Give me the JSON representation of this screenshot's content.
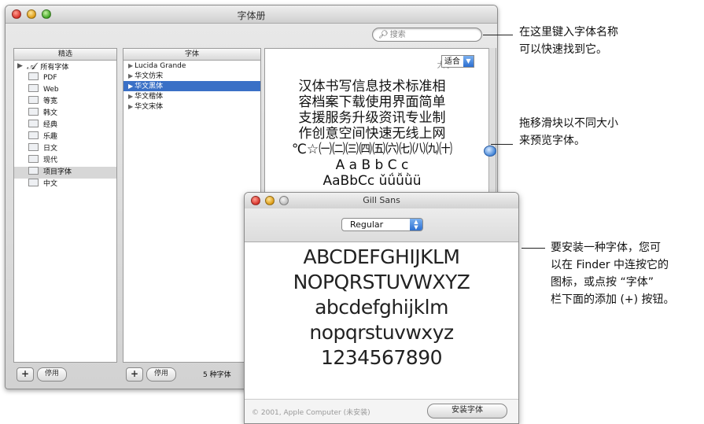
{
  "window": {
    "title": "字体册",
    "search_placeholder": "搜索",
    "search_icon": "magnifier-icon"
  },
  "collections": {
    "header": "精选",
    "items": [
      {
        "label": "所有字体",
        "icon": "all-fonts-icon"
      },
      {
        "label": "PDF",
        "icon": "collection-icon"
      },
      {
        "label": "Web",
        "icon": "collection-icon"
      },
      {
        "label": "等宽",
        "icon": "collection-icon"
      },
      {
        "label": "韩文",
        "icon": "collection-icon"
      },
      {
        "label": "经典",
        "icon": "collection-icon"
      },
      {
        "label": "乐趣",
        "icon": "collection-icon"
      },
      {
        "label": "日文",
        "icon": "collection-icon"
      },
      {
        "label": "现代",
        "icon": "collection-icon"
      },
      {
        "label": "项目字体",
        "icon": "collection-icon",
        "selected": true
      },
      {
        "label": "中文",
        "icon": "collection-icon"
      }
    ],
    "add_label": "+",
    "disable_label": "停用"
  },
  "fonts": {
    "header": "字体",
    "items": [
      {
        "label": "Lucida Grande"
      },
      {
        "label": "华文仿宋"
      },
      {
        "label": "华文黑体",
        "selected": true
      },
      {
        "label": "华文楷体"
      },
      {
        "label": "华文宋体"
      }
    ],
    "add_label": "+",
    "disable_label": "停用",
    "count_text": "5 种字体"
  },
  "preview": {
    "size_label": "大小:",
    "size_value": "适合",
    "lines": [
      "汉体书写信息技术标准相",
      "容档案下载使用界面简单",
      "支援服务升级资讯专业制",
      "作创意空间快速无线上网",
      "℃☆㈠㈡㈢㈣㈤㈥㈦㈧㈨㈩",
      "A a B b C c",
      "AaBbCc ǔǘǚǜü"
    ]
  },
  "gill_window": {
    "title": "Gill Sans",
    "style_value": "Regular",
    "lines": [
      "ABCDEFGHIJKLM",
      "NOPQRSTUVWXYZ",
      "abcdefghijklm",
      "nopqrstuvwxyz",
      "1234567890"
    ],
    "copyright": "© 2001, Apple Computer (未安装)",
    "install_label": "安装字体"
  },
  "callouts": {
    "search_lines": [
      "在这里键入字体名称",
      "可以快速找到它。"
    ],
    "slider_lines": [
      "拖移滑块以不同大小",
      "来预览字体。"
    ],
    "install_lines": [
      "要安装一种字体，您可",
      "以在 Finder 中连按它的",
      "图标，或点按 “字体”",
      "栏下面的添加 (+) 按钮。"
    ]
  }
}
